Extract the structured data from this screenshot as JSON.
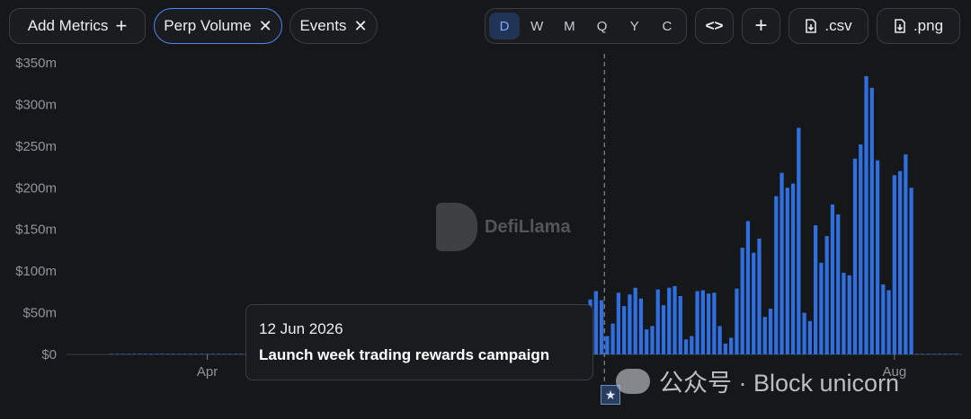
{
  "toolbar": {
    "add_metrics": "Add Metrics",
    "add_icon": "+",
    "chip_perp": "Perp Volume",
    "chip_events": "Events",
    "close_icon": "✕",
    "periods": [
      "D",
      "W",
      "M",
      "Q",
      "Y",
      "C"
    ],
    "selected_period": "D",
    "embed_icon": "<>",
    "plus_icon": "+",
    "csv_label": ".csv",
    "png_label": ".png"
  },
  "tooltip": {
    "date": "12 Jun 2026",
    "label": "Launch week trading rewards campaign"
  },
  "watermark": {
    "brand": "DefiLlama",
    "footer": "公众号 · Block unicorn"
  },
  "colors": {
    "bar": "#2f6fe0",
    "accent": "#4f84f7",
    "background": "#161719"
  },
  "chart_data": {
    "type": "bar",
    "series": [
      {
        "name": "Perp Volume"
      }
    ],
    "ylim": [
      0,
      350
    ],
    "yticks": [
      "$0",
      "$50m",
      "$100m",
      "$150m",
      "$200m",
      "$250m",
      "$300m",
      "$350m"
    ],
    "ytick_values": [
      0,
      50,
      100,
      150,
      200,
      250,
      300,
      350
    ],
    "xtick_labels": [
      "Apr",
      "Aug"
    ],
    "xtick_dates": [
      "2026-04-01",
      "2026-08-01"
    ],
    "x_range": [
      "2026-03-07",
      "2026-08-13"
    ],
    "event_date": "2026-06-12",
    "y_unit": "USD millions",
    "dates": [
      "2026-03-15",
      "2026-03-16",
      "2026-03-17",
      "2026-03-18",
      "2026-03-19",
      "2026-03-20",
      "2026-03-21",
      "2026-03-22",
      "2026-03-23",
      "2026-03-24",
      "2026-03-25",
      "2026-03-26",
      "2026-03-27",
      "2026-03-28",
      "2026-03-29",
      "2026-03-30",
      "2026-03-31",
      "2026-04-01",
      "2026-04-02",
      "2026-04-03",
      "2026-04-04",
      "2026-04-05",
      "2026-04-06",
      "2026-04-07",
      "2026-04-08",
      "2026-04-09",
      "2026-04-10",
      "2026-04-11",
      "2026-04-12",
      "2026-04-13",
      "2026-04-14",
      "2026-04-15",
      "2026-04-16",
      "2026-04-17",
      "2026-04-18",
      "2026-04-19",
      "2026-04-20",
      "2026-04-21",
      "2026-04-22",
      "2026-04-23",
      "2026-04-24",
      "2026-04-25",
      "2026-04-26",
      "2026-04-27",
      "2026-04-28",
      "2026-04-29",
      "2026-04-30",
      "2026-05-01",
      "2026-05-02",
      "2026-05-03",
      "2026-05-04",
      "2026-05-05",
      "2026-05-06",
      "2026-05-07",
      "2026-05-08",
      "2026-05-09",
      "2026-05-10",
      "2026-05-11",
      "2026-05-12",
      "2026-05-13",
      "2026-05-14",
      "2026-05-15",
      "2026-05-16",
      "2026-05-17",
      "2026-05-18",
      "2026-05-19",
      "2026-05-20",
      "2026-05-21",
      "2026-05-22",
      "2026-05-23",
      "2026-05-24",
      "2026-05-25",
      "2026-05-26",
      "2026-05-27",
      "2026-05-28",
      "2026-05-29",
      "2026-05-30",
      "2026-05-31",
      "2026-06-01",
      "2026-06-02",
      "2026-06-03",
      "2026-06-04",
      "2026-06-05",
      "2026-06-06",
      "2026-06-07",
      "2026-06-08",
      "2026-06-09",
      "2026-06-10",
      "2026-06-11",
      "2026-06-12",
      "2026-06-13",
      "2026-06-14",
      "2026-06-15",
      "2026-06-16",
      "2026-06-17",
      "2026-06-18",
      "2026-06-19",
      "2026-06-20",
      "2026-06-21",
      "2026-06-22",
      "2026-06-23",
      "2026-06-24",
      "2026-06-25",
      "2026-06-26",
      "2026-06-27",
      "2026-06-28",
      "2026-06-29",
      "2026-06-30",
      "2026-07-01",
      "2026-07-02",
      "2026-07-03",
      "2026-07-04",
      "2026-07-05",
      "2026-07-06",
      "2026-07-07",
      "2026-07-08",
      "2026-07-09",
      "2026-07-10",
      "2026-07-11",
      "2026-07-12",
      "2026-07-13",
      "2026-07-14",
      "2026-07-15",
      "2026-07-16",
      "2026-07-17",
      "2026-07-18",
      "2026-07-19",
      "2026-07-20",
      "2026-07-21",
      "2026-07-22",
      "2026-07-23",
      "2026-07-24",
      "2026-07-25",
      "2026-07-26",
      "2026-07-27",
      "2026-07-28",
      "2026-07-29",
      "2026-07-30",
      "2026-07-31",
      "2026-08-01",
      "2026-08-02",
      "2026-08-03",
      "2026-08-04",
      "2026-08-05",
      "2026-08-06",
      "2026-08-07",
      "2026-08-08",
      "2026-08-09",
      "2026-08-10",
      "2026-08-11",
      "2026-08-12"
    ],
    "values": [
      0,
      0,
      0,
      0,
      0,
      0,
      0,
      0,
      0,
      0,
      0,
      0,
      0,
      0,
      0,
      0,
      0,
      0,
      0,
      0,
      0,
      0,
      0,
      0,
      0,
      0,
      0,
      0,
      0,
      0,
      0,
      0,
      0,
      0,
      0,
      0,
      0,
      0,
      0,
      0,
      0,
      0,
      0,
      0,
      0,
      0,
      0,
      0,
      0,
      0,
      0,
      0,
      0,
      0,
      0,
      0,
      0,
      0,
      0,
      0,
      0,
      0,
      0,
      0,
      0,
      0,
      0,
      0,
      0,
      0,
      0,
      0,
      0,
      0,
      0,
      0,
      0,
      0,
      0,
      0,
      0,
      0,
      0,
      0,
      0,
      0,
      0,
      0,
      0,
      0,
      0,
      0,
      0,
      0,
      0,
      0,
      0,
      0,
      0,
      0,
      0,
      0,
      0,
      0,
      0,
      0,
      0,
      0,
      0,
      0,
      0,
      0,
      0,
      0,
      0,
      0,
      0,
      0,
      0,
      0,
      0,
      0,
      0,
      0,
      0,
      0,
      0,
      0,
      0,
      0,
      0,
      0,
      0,
      0,
      0,
      0,
      0,
      0,
      0,
      0,
      0,
      0,
      0,
      0,
      0,
      0,
      0,
      0,
      0,
      0,
      0
    ],
    "values_tail_from": "2026-06-08",
    "values_tail": [
      66,
      76,
      65,
      22,
      37,
      74,
      58,
      72,
      80,
      67,
      30,
      34,
      78,
      59,
      80,
      82,
      70,
      18,
      22,
      76,
      77,
      73,
      74,
      34,
      13,
      20,
      79,
      128,
      160,
      122,
      139,
      45,
      55,
      190,
      218,
      200,
      205,
      272,
      50,
      40,
      155,
      110,
      142,
      180,
      168,
      98,
      95,
      235,
      252,
      334,
      320,
      233,
      84,
      77,
      215,
      220,
      240,
      200
    ]
  }
}
